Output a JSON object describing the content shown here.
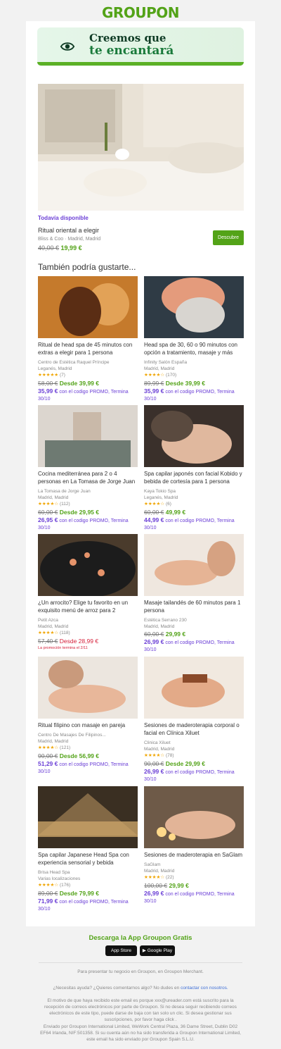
{
  "brand": {
    "logo": "GROUPON"
  },
  "hero": {
    "line1": "Creemos que",
    "line2": "te encantará"
  },
  "featured": {
    "availability": "Todavía disponible",
    "title": "Ritual oriental a elegir",
    "merchant": "Bliss & Coo",
    "location": "Madrid, Madrid",
    "old_price": "40,00 €",
    "price": "19,99 €",
    "cta": "Descubre"
  },
  "also_heading": "También podría gustarte...",
  "deals": [
    {
      "title": "Ritual de head spa de 45 minutos con extras a elegir para 1 persona",
      "merchant": "Centro de Estética Raquel Príncipe",
      "location": "Leganés, Madrid",
      "stars": "★★★★★",
      "count": "(7)",
      "old": "58,00 €",
      "from": "Desde 39,99 €",
      "promo": "35,99 €",
      "promo_text": "con el codigo PROMO, Termina 30/10"
    },
    {
      "title": "Head spa de 30, 60 o 90 minutos con opción a tratamiento, masaje y más",
      "merchant": "Infinity Salón España",
      "location": "Madrid, Madrid",
      "stars": "★★★★☆",
      "count": "(170)",
      "old": "89,99 €",
      "from": "Desde 39,99 €",
      "promo": "35,99 €",
      "promo_text": "con el codigo PROMO, Termina 30/10"
    },
    {
      "title": "Cocina mediterránea para 2 o 4 personas en La Tomasa de Jorge Juan",
      "merchant": "La Tomasa de Jorge Juan",
      "location": "Madrid, Madrid",
      "stars": "★★★★☆",
      "count": "(112)",
      "old": "60,00 €",
      "from": "Desde 29,95 €",
      "promo": "26,95 €",
      "promo_text": "con el codigo PROMO, Termina 30/10"
    },
    {
      "title": "Spa capilar japonés con facial Kobido y bebida de cortesía para 1 persona",
      "merchant": "Kaya Tokio Spa",
      "location": "Leganés, Madrid",
      "stars": "★★★★☆",
      "count": "(6)",
      "old": "60,00 €",
      "from": "49,99 €",
      "promo": "44,99 €",
      "promo_text": "con el codigo PROMO, Termina 30/10"
    },
    {
      "title": "¿Un arrocito? Elige tu favorito en un exquisito menú de arroz para 2",
      "merchant": "Petit Azca",
      "location": "Madrid, Madrid",
      "stars": "★★★★☆",
      "count": "(118)",
      "old": "57,40 €",
      "from": "Desde 28,99 €",
      "ends": "La promoción termina el 2/11"
    },
    {
      "title": "Masaje tailandés de 60 minutos para 1 persona",
      "merchant": "Estética Serrano 230",
      "location": "Madrid, Madrid",
      "old": "60,00 €",
      "from": "29,99 €",
      "promo": "26,99 €",
      "promo_text": "con el codigo PROMO, Termina 30/10"
    },
    {
      "title": "Ritual filipino con masaje en pareja",
      "merchant": "Centro De Masajes De Filipinos...",
      "location": "Madrid, Madrid",
      "stars": "★★★★☆",
      "count": "(121)",
      "old": "90,00 €",
      "from": "Desde 56,99 €",
      "promo": "51,29 €",
      "promo_text": "con el codigo PROMO, Termina 30/10"
    },
    {
      "title": "Sesiones de maderoterapia corporal o facial en Clínica Xiluet",
      "merchant": "Clinica Xiluet",
      "location": "Madrid, Madrid",
      "stars": "★★★★☆",
      "count": "(78)",
      "old": "90,00 €",
      "from": "Desde 29,99 €",
      "promo": "26,99 €",
      "promo_text": "con el codigo PROMO, Termina 30/10"
    },
    {
      "title": "Spa capilar Japanese Head Spa con experiencia sensorial y bebida",
      "merchant": "Brisa Head Spa",
      "location": "Varias localizaciones",
      "stars": "★★★★☆",
      "count": "(176)",
      "old": "89,00 €",
      "from": "Desde 79,99 €",
      "promo": "71,99 €",
      "promo_text": "con el codigo PROMO, Termina 30/10"
    },
    {
      "title": "Sesiones de maderoterapia en SaGlam",
      "merchant": "SaGlam",
      "location": "Madrid, Madrid",
      "stars": "★★★★☆",
      "count": "(22)",
      "old": "100,00 €",
      "from": "29,99 €",
      "promo": "26,99 €",
      "promo_text": "con el codigo PROMO, Termina 30/10"
    }
  ],
  "footer": {
    "app_heading": "Descarga la App Groupon Gratis",
    "app_store": "App Store",
    "google_play": "Google Play",
    "merchant_line": "Para presentar tu negocio en Groupon, en Groupon Merchant.",
    "help": "¿Necesitas ayuda? ¿Quieres comentarnos algo? No dudes en",
    "help_link": "contactar con nosotros.",
    "reason": "El motivo de que haya recibido este email es porque xxx@ureader.com está suscrito para la recepción de correos electrónicos por parte de Groupon. Si no desea seguir recibiendo correos electrónicos de este tipo, puede darse de baja con tan solo un clic. Si desea gestionar sus suscripciones, por favor haga click .",
    "legal": "Enviado por Groupon International Limited, WeWork Central Plaza, 36 Dame Street, Dublin D02 EF64 Irlanda, NIF:501358. Si su cuenta aún no ha sido transferida a Groupon International Limited, este email ha sido enviado por Groupon Spain S.L.U."
  },
  "colors": {
    "brand_green": "#53a318",
    "promo_purple": "#6b3fd6",
    "sale_red": "#d5203a"
  }
}
